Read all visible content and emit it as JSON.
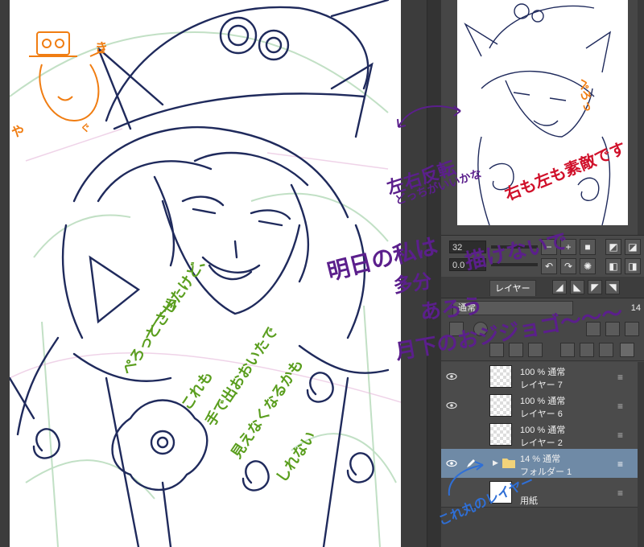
{
  "navigator": {
    "zoom_value": "32",
    "rotation_value": "0.0"
  },
  "layer_panel": {
    "tabs": [
      "レイヤー"
    ],
    "blend_mode": "通常",
    "opacity": "14",
    "layers": [
      {
        "mode": "100 % 通常",
        "name": "レイヤー 7",
        "visible": true,
        "selected": false,
        "type": "raster"
      },
      {
        "mode": "100 % 通常",
        "name": "レイヤー 6",
        "visible": true,
        "selected": false,
        "type": "raster"
      },
      {
        "mode": "100 % 通常",
        "name": "レイヤー 2",
        "visible": false,
        "selected": false,
        "type": "raster"
      },
      {
        "mode": "14 % 通常",
        "name": "フォルダー 1",
        "visible": true,
        "selected": true,
        "type": "folder"
      },
      {
        "mode": "",
        "name": "用紙",
        "visible": false,
        "selected": false,
        "type": "paper"
      }
    ]
  },
  "annotations": {
    "hat_label_left": "や",
    "hat_label_right": "き",
    "sparkle": "ぐ",
    "flip_title": "左右反転",
    "flip_sub": "どっちがいいかな",
    "both_sides": "右も左も素敵です",
    "tomorrow_1": "明日の私は",
    "tomorrow_2": "多分",
    "tomorrow_3": "描けないで",
    "tomorrow_4": "あろう",
    "tomorrow_5": "月下のおジジョゴ〜〜〜",
    "green_1": "ぺろっとさせたけど、",
    "green_2": "これも",
    "green_3": "手で出おおいたで",
    "green_4": "見えなくなるかも",
    "green_5": "しれない",
    "blue_1": "これ丸のレイヤー",
    "nav_pero": "ぺろっ"
  },
  "colors": {
    "line_navy": "#1f2a5c",
    "sketch_green": "#7ab07f",
    "anno_purple": "#5b1f8c",
    "anno_red": "#d0102a",
    "anno_blue": "#2f6fd6",
    "anno_orange": "#f07d12",
    "anno_green": "#5a9e1e",
    "selected_layer": "#6f8aa6"
  }
}
